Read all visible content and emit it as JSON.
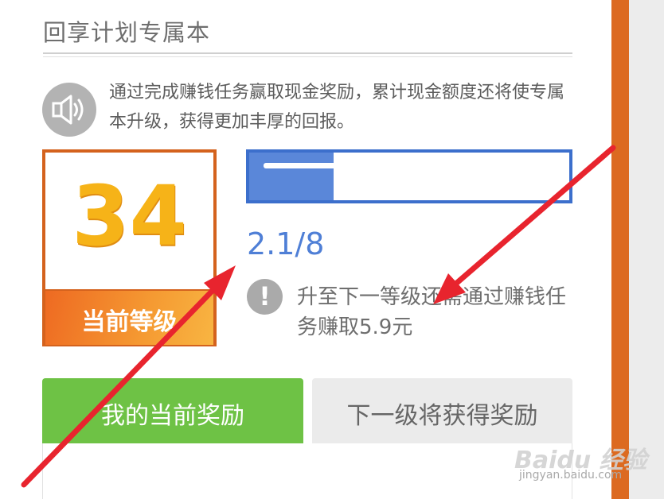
{
  "header": {
    "title": "回享计划专属本"
  },
  "intro": {
    "text": "通过完成赚钱任务赢取现金奖励，累计现金额度还将使专属本升级，获得更加丰厚的回报。"
  },
  "level": {
    "number": "34",
    "label": "当前等级"
  },
  "progress": {
    "current": 2.1,
    "total": 8,
    "fraction": 0.2625,
    "text": "2.1/8"
  },
  "hint": {
    "text": "升至下一等级还需通过赚钱任务赚取5.9元"
  },
  "tabs": [
    {
      "label": "我的当前奖励",
      "active": true
    },
    {
      "label": "下一级将获得奖励",
      "active": false
    }
  ],
  "watermark": {
    "brand": "Baidu 经验",
    "url": "jingyan.baidu.com"
  },
  "colors": {
    "accent_orange": "#dc6a21",
    "progress_blue": "#3c6fcc",
    "tab_green": "#6ec245",
    "level_gold": "#f6b318",
    "annotation_red": "#e8242e"
  },
  "icons": {
    "speaker": "speaker-icon",
    "info": "exclamation-icon"
  }
}
